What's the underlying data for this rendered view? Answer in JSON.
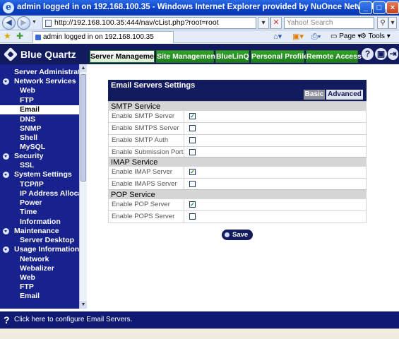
{
  "window": {
    "title": "admin logged in on 192.168.100.35 - Windows Internet Explorer provided by NuOnce Networks, Inc."
  },
  "browser": {
    "address": "http://192.168.100.35:444/nav/cList.php?root=root",
    "search_placeholder": "Yahoo! Search",
    "tab_label": "admin logged in on 192.168.100.35",
    "page_label": "Page",
    "tools_label": "Tools"
  },
  "app": {
    "brand": "Blue Quartz",
    "nav_tabs": [
      {
        "label": "Server Management",
        "active": true
      },
      {
        "label": "Site Management"
      },
      {
        "label": "BlueLinQ"
      },
      {
        "label": "Personal Profile"
      },
      {
        "label": "Remote Access"
      }
    ]
  },
  "sidebar": {
    "items": [
      {
        "label": "Server Administrators"
      },
      {
        "label": "Network Services",
        "toggle": true
      },
      {
        "label": "Web"
      },
      {
        "label": "FTP"
      },
      {
        "label": "Email",
        "active": true
      },
      {
        "label": "DNS"
      },
      {
        "label": "SNMP"
      },
      {
        "label": "Shell"
      },
      {
        "label": "MySQL"
      },
      {
        "label": "Security",
        "toggle": true
      },
      {
        "label": "SSL"
      },
      {
        "label": "System Settings",
        "toggle": true
      },
      {
        "label": "TCP/IP"
      },
      {
        "label": "IP Address Allocation"
      },
      {
        "label": "Power"
      },
      {
        "label": "Time"
      },
      {
        "label": "Information"
      },
      {
        "label": "Maintenance",
        "toggle": true
      },
      {
        "label": "Server Desktop"
      },
      {
        "label": "Usage Information",
        "toggle": true
      },
      {
        "label": "Network"
      },
      {
        "label": "Webalizer"
      },
      {
        "label": "Web"
      },
      {
        "label": "FTP"
      },
      {
        "label": "Email"
      }
    ]
  },
  "panel": {
    "title": "Email Servers Settings",
    "tab_basic": "Basic",
    "tab_advanced": "Advanced",
    "sections": [
      {
        "title": "SMTP Service",
        "rows": [
          {
            "label": "Enable SMTP Server",
            "checked": true
          },
          {
            "label": "Enable SMTPS Server",
            "checked": false
          },
          {
            "label": "Enable SMTP Auth",
            "checked": false
          },
          {
            "label": "Enable Submission Port",
            "checked": false
          }
        ]
      },
      {
        "title": "IMAP Service",
        "rows": [
          {
            "label": "Enable IMAP Server",
            "checked": true
          },
          {
            "label": "Enable IMAPS Server",
            "checked": false
          }
        ]
      },
      {
        "title": "POP Service",
        "rows": [
          {
            "label": "Enable POP Server",
            "checked": true
          },
          {
            "label": "Enable POPS Server",
            "checked": false
          }
        ]
      }
    ],
    "save_label": "Save"
  },
  "footer": {
    "help_text": "Click here to configure Email Servers."
  }
}
